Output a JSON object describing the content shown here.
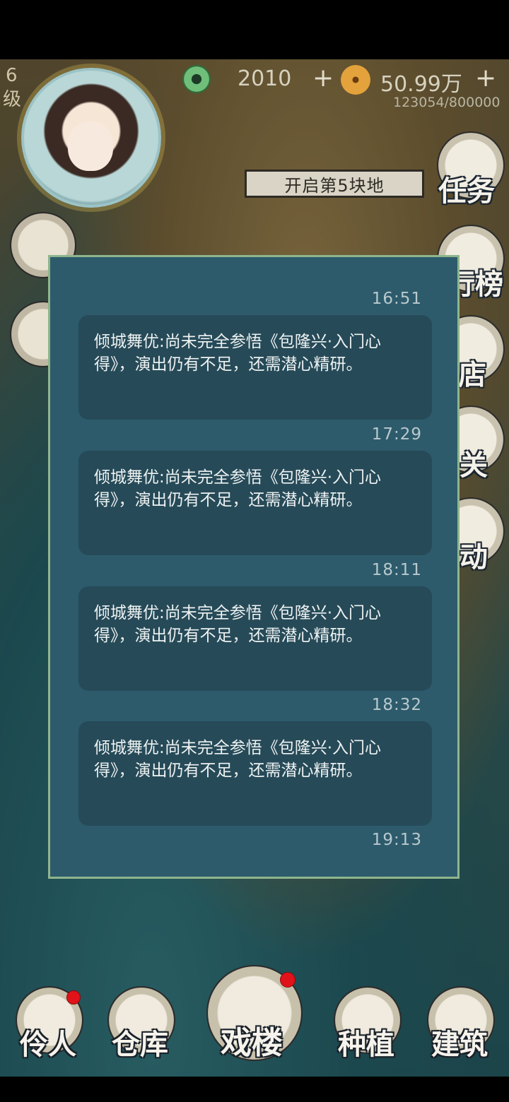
{
  "hud": {
    "level_number": "6",
    "level_unit": "级",
    "jade_count": "2010",
    "jade_add": "+",
    "coin_count": "50.99万",
    "coin_add": "+",
    "experience": "123054/800000"
  },
  "map": {
    "unlock_plot_label": "开启第5块地"
  },
  "side_menu": {
    "items": [
      {
        "label": "任务",
        "icon": "scroll-icon"
      },
      {
        "label": "行榜",
        "icon": "banner-icon"
      },
      {
        "label": "店",
        "icon": "cat-shop-icon"
      },
      {
        "label": "关",
        "icon": "drum-icon"
      },
      {
        "label": "动",
        "icon": "lantern-icon"
      }
    ]
  },
  "message_log": {
    "messages": [
      {
        "time": "16:51",
        "text": "倾城舞优:尚未完全参悟《包隆兴·入门心得》，演出仍有不足，还需潜心精研。"
      },
      {
        "time": "17:29",
        "text": "倾城舞优:尚未完全参悟《包隆兴·入门心得》，演出仍有不足，还需潜心精研。"
      },
      {
        "time": "18:11",
        "text": "倾城舞优:尚未完全参悟《包隆兴·入门心得》，演出仍有不足，还需潜心精研。"
      },
      {
        "time": "18:32",
        "text": "倾城舞优:尚未完全参悟《包隆兴·入门心得》，演出仍有不足，还需潜心精研。"
      }
    ],
    "last_time": "19:13"
  },
  "bottom_nav": {
    "items": [
      {
        "label": "伶人",
        "has_badge": true
      },
      {
        "label": "仓库",
        "has_badge": false
      },
      {
        "label": "戏楼",
        "has_badge": true
      },
      {
        "label": "种植",
        "has_badge": false
      },
      {
        "label": "建筑",
        "has_badge": false
      }
    ]
  },
  "colors": {
    "dialog_bg": "#2d5b6c",
    "bubble_bg": "#264a58",
    "dialog_border": "#8fb58c",
    "badge": "#e0121a"
  }
}
